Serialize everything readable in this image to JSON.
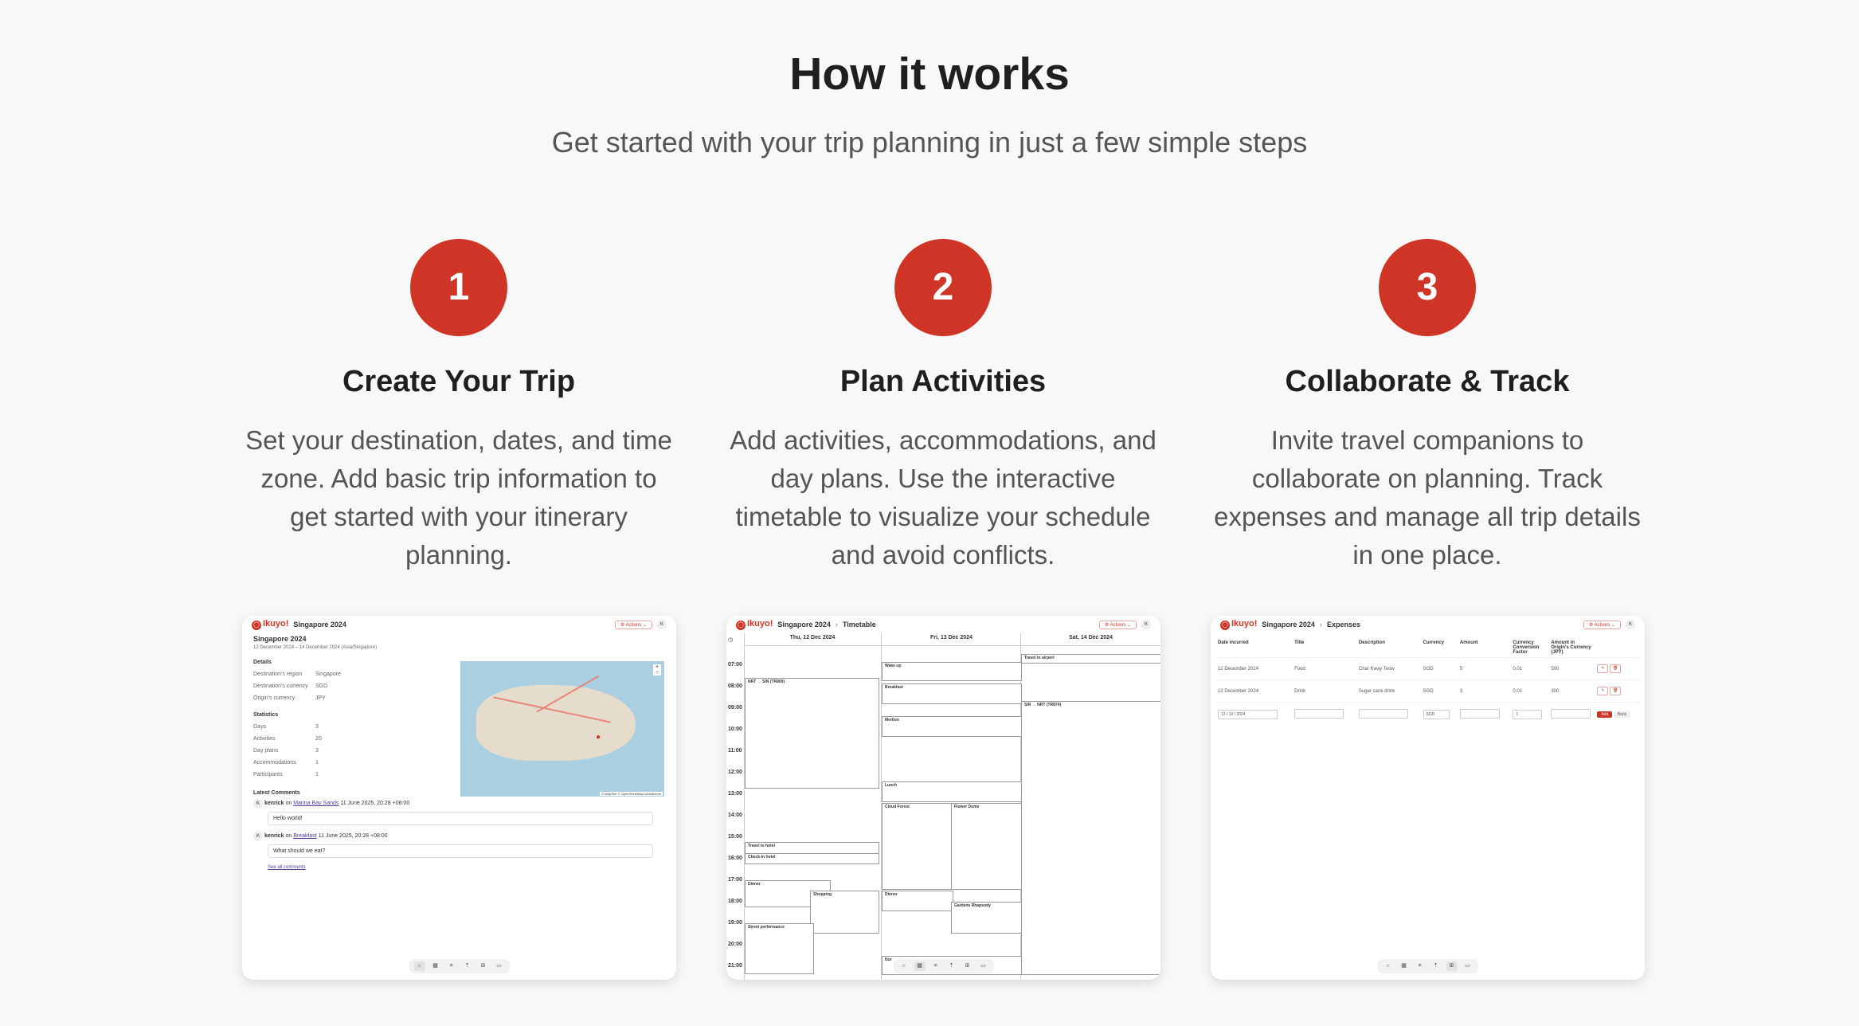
{
  "header": {
    "title": "How it works",
    "subtitle": "Get started with your trip planning in just a few simple steps"
  },
  "steps": [
    {
      "number": "1",
      "title": "Create Your Trip",
      "text": "Set your destination, dates, and time zone. Add basic trip information to get started with your itinerary planning."
    },
    {
      "number": "2",
      "title": "Plan Activities",
      "text": "Add activities, accommodations, and day plans. Use the interactive timetable to visualize your schedule and avoid conflicts."
    },
    {
      "number": "3",
      "title": "Collaborate & Track",
      "text": "Invite travel companions to collaborate on planning. Track expenses and manage all trip details in one place."
    }
  ],
  "brand": {
    "logo": "Ikuyo!",
    "accent": "#cf3526"
  },
  "shot1": {
    "trip": "Singapore 2024",
    "dates": "12 December 2024 – 14 December 2024 (Asia/Singapore)",
    "actions": "Actions",
    "avatar": "K",
    "details_h": "Details",
    "details": [
      {
        "k": "Destination's region",
        "v": "Singapore"
      },
      {
        "k": "Destination's currency",
        "v": "SGD"
      },
      {
        "k": "Origin's currency",
        "v": "JPY"
      }
    ],
    "stats_h": "Statistics",
    "stats": [
      {
        "k": "Days",
        "v": "3"
      },
      {
        "k": "Activities",
        "v": "20"
      },
      {
        "k": "Day plans",
        "v": "3"
      },
      {
        "k": "Accommodations",
        "v": "1"
      },
      {
        "k": "Participants",
        "v": "1"
      }
    ],
    "comments_h": "Latest Comments",
    "comments": [
      {
        "author": "kenrick",
        "on": "on",
        "target": "Marina Bay Sands",
        "time": "11 June 2025, 20:28 +08:00",
        "text": "Hello world!"
      },
      {
        "author": "kenrick",
        "on": "on",
        "target": "Breakfast",
        "time": "11 June 2025, 20:28 +08:00",
        "text": "What should we eat?"
      }
    ],
    "see_all": "See all comments",
    "map_credit": "© MapTiler © OpenStreetMap contributors"
  },
  "shot2": {
    "trip": "Singapore 2024",
    "section": "Timetable",
    "days": [
      "Thu, 12 Dec 2024",
      "Fri, 13 Dec 2024",
      "Sat, 14 Dec 2024"
    ],
    "times": [
      "07:00",
      "08:00",
      "09:00",
      "10:00",
      "11:00",
      "12:00",
      "13:00",
      "14:00",
      "15:00",
      "16:00",
      "17:00",
      "18:00",
      "19:00",
      "20:00",
      "21:00"
    ],
    "blocks": {
      "flight1": "NRT → SIN (TR809)",
      "wake": "Wake up",
      "breakfast": "Breakfast",
      "merlion": "Merlion",
      "lunch": "Lunch",
      "cloud": "Cloud Forest",
      "flower": "Flower Dome",
      "dinner2": "Dinner",
      "gardens": "Gardens Rhapsody",
      "hotel": "Travel to hotel",
      "checkin": "Check-in hotel",
      "dinner1": "Dinner",
      "shopping": "Shopping",
      "street": "Street performance",
      "airport": "Travel to airport",
      "flight2": "SIN → NRT (TR874)",
      "night": "Nor"
    }
  },
  "shot3": {
    "trip": "Singapore 2024",
    "section": "Expenses",
    "columns": [
      "Date incurred",
      "Title",
      "Description",
      "Currency",
      "Amount",
      "Currency Conversion Factor",
      "Amount in Origin's Currency (JPY)"
    ],
    "rows": [
      [
        "12 December 2024",
        "Food",
        "Char Kway Teow",
        "SGD",
        "5",
        "0.01",
        "500"
      ],
      [
        "12 December 2024",
        "Drink",
        "Sugar cane drink",
        "SGD",
        "3",
        "0.01",
        "300"
      ]
    ],
    "new_row": {
      "date": "12 / 12 / 2024",
      "currency": "SGD",
      "factor": "1",
      "add": "Add",
      "back": "Back"
    }
  },
  "bottom_nav_icons": [
    "home-icon",
    "calendar-icon",
    "list-icon",
    "pin-icon",
    "table-icon",
    "chat-icon"
  ]
}
